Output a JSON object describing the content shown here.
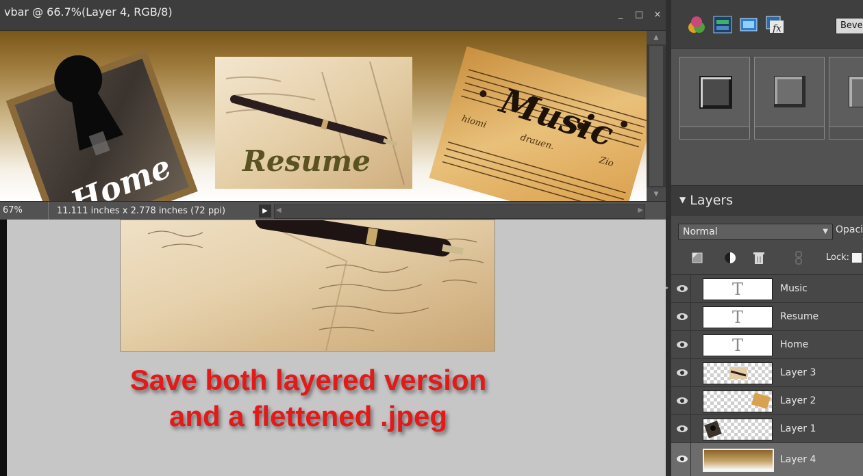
{
  "document": {
    "title": "vbar @ 66.7%(Layer 4, RGB/8)",
    "window_buttons": {
      "minimize": "_",
      "maximize": "□",
      "close": "×"
    }
  },
  "canvas": {
    "home_text": "Home",
    "resume_text": "Resume",
    "music_text": "Music",
    "sheet_lyric_1": "hiomi",
    "sheet_lyric_2": "drauen.",
    "sheet_lyric_3": "Zio"
  },
  "status": {
    "zoom": "67%",
    "size": "11.111 inches x 2.778 inches (72 ppi)",
    "menu_glyph": "▶"
  },
  "caption": {
    "line1": "Save both layered version",
    "line2": "and a flettened .jpeg"
  },
  "panel": {
    "effects_dropdown": "Bevels",
    "layers_title": "Layers",
    "blend_mode": "Normal",
    "opacity_label": "Opacity:",
    "lock_label": "Lock:",
    "layers": [
      {
        "name": "Music",
        "type": "text",
        "visible": true
      },
      {
        "name": "Resume",
        "type": "text",
        "visible": true
      },
      {
        "name": "Home",
        "type": "text",
        "visible": true
      },
      {
        "name": "Layer 3",
        "type": "image",
        "visible": true
      },
      {
        "name": "Layer 2",
        "type": "image",
        "visible": true
      },
      {
        "name": "Layer 1",
        "type": "image",
        "visible": true
      },
      {
        "name": "Layer 4",
        "type": "gradient",
        "visible": true,
        "selected": true
      }
    ]
  },
  "colors": {
    "caption_red": "#e3191a",
    "panel_bg": "#494949",
    "selected_layer": "#6c6c6c",
    "gradient_dark": "#7a5618"
  }
}
